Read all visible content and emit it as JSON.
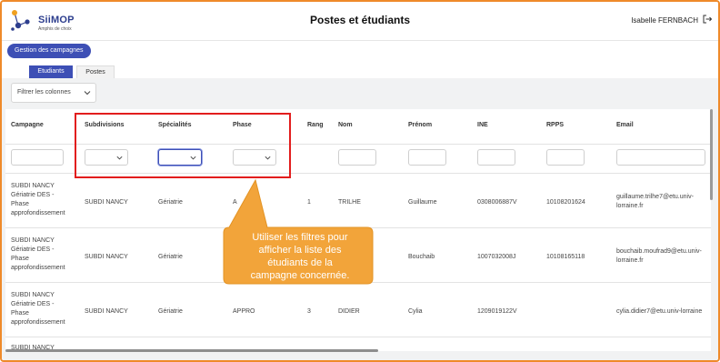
{
  "app": {
    "logo_name": "SiiMOP",
    "logo_tagline": "Amphis de choix",
    "page_title": "Postes et étudiants",
    "user_name": "Isabelle FERNBACH"
  },
  "nav": {
    "campaign_button": "Gestion des campagnes",
    "tabs": [
      {
        "label": "Etudiants",
        "active": true
      },
      {
        "label": "Postes",
        "active": false
      }
    ]
  },
  "filter_columns": {
    "label": "Filtrer les colonnes"
  },
  "table": {
    "headers": [
      "Campagne",
      "Subdivisions",
      "Spécialités",
      "Phase",
      "Rang",
      "Nom",
      "Prénom",
      "INE",
      "RPPS",
      "Email"
    ],
    "rows": [
      {
        "campagne": [
          "SUBDI NANCY",
          "Gériatrie DES -",
          "Phase",
          "approfondissement"
        ],
        "subdivision": "SUBDI NANCY",
        "specialite": "Gériatrie",
        "phase": "A",
        "rang": "1",
        "nom": "TRILHE",
        "prenom": "Guillaume",
        "ine": "0308006887V",
        "rpps": "10108201624",
        "email": [
          "guillaume.trilhe7@etu.univ-",
          "lorraine.fr"
        ]
      },
      {
        "campagne": [
          "SUBDI NANCY",
          "Gériatrie DES -",
          "Phase",
          "approfondissement"
        ],
        "subdivision": "SUBDI NANCY",
        "specialite": "Gériatrie",
        "phase": "",
        "rang": "",
        "nom": "",
        "prenom": "Bouchaib",
        "ine": "1007032008J",
        "rpps": "10108165118",
        "email": [
          "bouchaib.moufrad9@etu.univ-",
          "lorraine.fr"
        ]
      },
      {
        "campagne": [
          "SUBDI NANCY",
          "Gériatrie DES -",
          "Phase",
          "approfondissement"
        ],
        "subdivision": "SUBDI NANCY",
        "specialite": "Gériatrie",
        "phase": "APPRO",
        "rang": "3",
        "nom": "DIDIER",
        "prenom": "Cylia",
        "ine": "1209019122V",
        "rpps": "",
        "email": [
          "cylia.didier7@etu.univ-lorraine",
          ""
        ]
      },
      {
        "campagne": [
          "SUBDI NANCY",
          "",
          "",
          ""
        ]
      }
    ]
  },
  "callout": {
    "lines": [
      "Utiliser les filtres pour",
      "afficher la liste des",
      "étudiants de la",
      "campagne concernée."
    ],
    "fill_color": "#f2a43a",
    "highlight_color": "#e21d1d"
  },
  "colors": {
    "brand": "#3d4fb5",
    "frame": "#ef8a2a"
  }
}
